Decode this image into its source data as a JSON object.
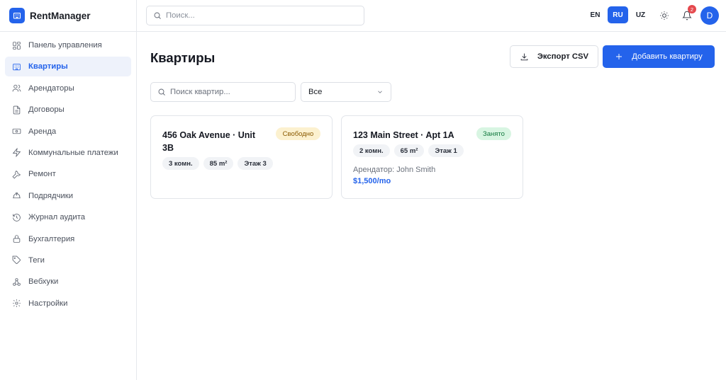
{
  "app": {
    "name": "RentManager",
    "logo_icon": "building-icon",
    "accent": "#2463eb"
  },
  "sidebar": {
    "items": [
      {
        "label": "Панель управления",
        "icon": "dashboard-icon",
        "active": false
      },
      {
        "label": "Квартиры",
        "icon": "building-icon",
        "active": true
      },
      {
        "label": "Арендаторы",
        "icon": "users-icon",
        "active": false
      },
      {
        "label": "Договоры",
        "icon": "document-icon",
        "active": false
      },
      {
        "label": "Аренда",
        "icon": "banknote-icon",
        "active": false
      },
      {
        "label": "Коммунальные платежи",
        "icon": "zap-icon",
        "active": false
      },
      {
        "label": "Ремонт",
        "icon": "wrench-icon",
        "active": false
      },
      {
        "label": "Подрядчики",
        "icon": "hardhat-icon",
        "active": false
      },
      {
        "label": "Журнал аудита",
        "icon": "history-icon",
        "active": false
      },
      {
        "label": "Бухгалтерия",
        "icon": "lock-icon",
        "active": false
      },
      {
        "label": "Теги",
        "icon": "tag-icon",
        "active": false
      },
      {
        "label": "Вебхуки",
        "icon": "webhook-icon",
        "active": false
      },
      {
        "label": "Настройки",
        "icon": "gear-icon",
        "active": false
      }
    ]
  },
  "topbar": {
    "search_placeholder": "Поиск...",
    "languages": [
      "EN",
      "RU",
      "UZ"
    ],
    "active_language": "RU",
    "notification_count": "2",
    "avatar_initial": "D"
  },
  "main": {
    "title": "Квартиры",
    "export_label": "Экспорт CSV",
    "add_label": "Добавить квартиру",
    "search_placeholder": "Поиск квартир...",
    "filter_value": "Все",
    "cards": [
      {
        "title": "456 Oak Avenue · Unit 3B",
        "status": "Свободно",
        "status_color": "#fcf1cf",
        "pills": [
          "3 комн.",
          "85 m²",
          "Этаж 3"
        ]
      },
      {
        "title": "123 Main Street · Apt 1A",
        "status": "Занято",
        "status_color": "#d8f5e2",
        "pills": [
          "2 комн.",
          "65 m²",
          "Этаж 1"
        ],
        "tenant": "Арендатор: John Smith",
        "rent": "$1,500/mo"
      }
    ]
  }
}
